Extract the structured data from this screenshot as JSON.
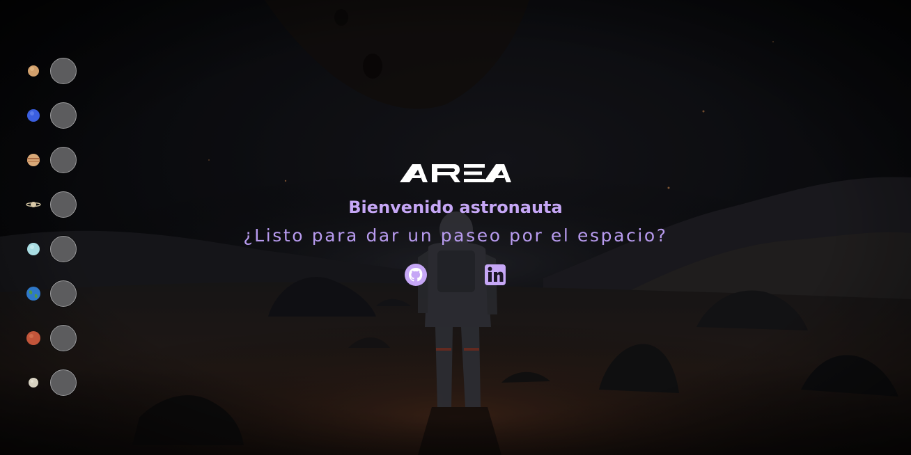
{
  "brand": {
    "logo_text": "AREA"
  },
  "hero": {
    "title": "Bienvenido astronauta",
    "subtitle": "¿Listo para dar un paseo por el espacio?"
  },
  "social": [
    {
      "name": "GitHub",
      "icon": "github-icon"
    },
    {
      "name": "LinkedIn",
      "icon": "linkedin-icon"
    }
  ],
  "planets": [
    {
      "name": "Venus",
      "icon": "venus-icon",
      "color": "#d2a06c"
    },
    {
      "name": "Neptune",
      "icon": "neptune-icon",
      "color": "#3b5fe0"
    },
    {
      "name": "Jupiter",
      "icon": "jupiter-icon",
      "color": "#d8a878"
    },
    {
      "name": "Saturn",
      "icon": "saturn-icon",
      "color": "#d9c9a8"
    },
    {
      "name": "Uranus",
      "icon": "uranus-icon",
      "color": "#a9dde3"
    },
    {
      "name": "Earth",
      "icon": "earth-icon",
      "color": "#2f78c8"
    },
    {
      "name": "Mars",
      "icon": "mars-icon",
      "color": "#c2553a"
    },
    {
      "name": "Mercury",
      "icon": "mercury-icon",
      "color": "#d8d2c2"
    }
  ],
  "colors": {
    "accent": "#c6a7f6",
    "background": "#07080b",
    "button": "#5c5c5e"
  }
}
